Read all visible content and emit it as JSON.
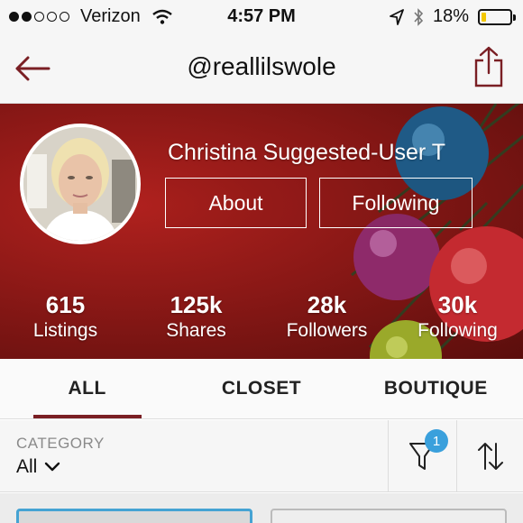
{
  "status_bar": {
    "carrier": "Verizon",
    "time": "4:57 PM",
    "battery_percent": "18%",
    "battery_level": 0.18,
    "battery_color": "#f3c700"
  },
  "nav": {
    "title": "@reallilswole",
    "back_icon": "back-arrow-icon",
    "share_icon": "share-icon"
  },
  "profile": {
    "name": "Christina Suggested-User T",
    "about_label": "About",
    "following_button_label": "Following",
    "stats": [
      {
        "value": "615",
        "label": "Listings"
      },
      {
        "value": "125k",
        "label": "Shares"
      },
      {
        "value": "28k",
        "label": "Followers"
      },
      {
        "value": "30k",
        "label": "Following"
      }
    ]
  },
  "tabs": [
    {
      "label": "ALL",
      "active": true
    },
    {
      "label": "CLOSET",
      "active": false
    },
    {
      "label": "BOUTIQUE",
      "active": false
    }
  ],
  "filter": {
    "category_label": "CATEGORY",
    "category_value": "All",
    "filter_badge_count": "1",
    "filter_icon": "filter-funnel-icon",
    "sort_icon": "sort-arrows-icon"
  },
  "colors": {
    "accent": "#7a1f24",
    "badge": "#3aa0dc"
  }
}
